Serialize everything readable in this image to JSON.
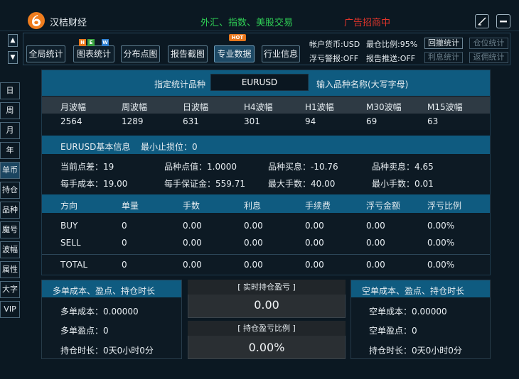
{
  "app": {
    "title": "汉桔财经",
    "slogan": "外汇、指数、美股交易",
    "ad": "广告招商中",
    "edit_icon": "edit-icon",
    "min_icon": "minimize-icon"
  },
  "toolbar": {
    "buttons": [
      "全局统计",
      "图表统计",
      "分布点图",
      "报告截图",
      "专业数据",
      "行业信息"
    ],
    "badge_new": [
      "N",
      "E",
      "W"
    ],
    "badge_hot": "HOT",
    "account_currency": "帐户货币:USD",
    "max_position": "最仓比例:95%",
    "pnl_alert": "浮亏警报:OFF",
    "report_push": "报告推送:OFF",
    "btn_withdraw": "回撤统计",
    "btn_position": "仓位统计",
    "btn_interest": "利息统计",
    "btn_rebate": "返佣统计"
  },
  "side": {
    "up": "▲",
    "down": "▼",
    "items": [
      "日",
      "周",
      "月",
      "年",
      "单币",
      "持仓",
      "品种",
      "魔号",
      "波幅",
      "属性",
      "大字",
      "VIP"
    ]
  },
  "symbol_bar": {
    "label": "指定统计品种",
    "value": "EURUSD",
    "hint": "输入品种名称(大写字母)"
  },
  "volatility": {
    "headers": [
      "月波幅",
      "周波幅",
      "日波幅",
      "H4波幅",
      "H1波幅",
      "M30波幅",
      "M15波幅"
    ],
    "values": [
      "2564",
      "1289",
      "631",
      "301",
      "94",
      "69",
      "63"
    ]
  },
  "basic": {
    "title": "EURUSD基本信息",
    "min_stop": "最小止损位：0",
    "row1": [
      "当前点差：19",
      "品种点值：1.0000",
      "品种买息：-10.76",
      "品种卖息：4.65"
    ],
    "row2": [
      "每手成本：19.00",
      "每手保证金：559.71",
      "最大手数：40.00",
      "最小手数：0.01"
    ]
  },
  "positions": {
    "headers": [
      "方向",
      "单量",
      "手数",
      "利息",
      "手续费",
      "浮亏金额",
      "浮亏比例"
    ],
    "rows": [
      [
        "BUY",
        "0",
        "0.00",
        "0.00",
        "0.00",
        "0.00",
        "0.00%"
      ],
      [
        "SELL",
        "0",
        "0.00",
        "0.00",
        "0.00",
        "0.00",
        "0.00%"
      ]
    ],
    "total": [
      "TOTAL",
      "0",
      "0.00",
      "0.00",
      "0.00",
      "0.00",
      "0.00%"
    ]
  },
  "long_box": {
    "title": "多单成本、盈点、持仓时长",
    "cost": "多单成本：0.00000",
    "points": "多单盈点：0",
    "duration": "持仓时长：0天0小时0分"
  },
  "short_box": {
    "title": "空单成本、盈点、持仓时长",
    "cost": "空单成本：0.00000",
    "points": "空单盈点：0",
    "duration": "持仓时长：0天0小时0分"
  },
  "realtime": {
    "title": "[ 实时持仓盈亏 ]",
    "value": "0.00"
  },
  "ratio": {
    "title": "[ 持仓盈亏比例 ]",
    "value": "0.00%"
  },
  "colors": {
    "accent": "#0f5b80",
    "green": "#2fcf55",
    "red": "#e0352b",
    "logo": "#f07d1e"
  }
}
